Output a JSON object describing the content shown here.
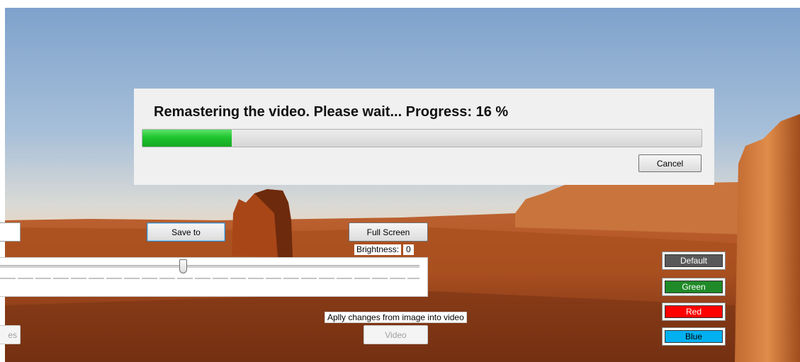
{
  "progress_dialog": {
    "message": "Remastering the video. Please wait... Progress: 16 %",
    "progress": 0.16,
    "cancel_label": "Cancel"
  },
  "toolbar": {
    "save_to_label": "Save to",
    "full_screen_label": "Full Screen",
    "brightness_label": "Brightness:",
    "brightness_value": "0"
  },
  "apply": {
    "hint": "Aplly changes from image into video",
    "video_label": "Video",
    "left_partial_label": "es"
  },
  "color_buttons": [
    {
      "label": "Default",
      "color": "#595959",
      "text_color": "#ffffff"
    },
    {
      "label": "Green",
      "color": "#1f8a27",
      "text_color": "#ffffff"
    },
    {
      "label": "Red",
      "color": "#ff0000",
      "text_color": "#ffffff"
    },
    {
      "label": "Blue",
      "color": "#00b0f0",
      "text_color": "#000000"
    }
  ],
  "colors": {
    "progress_fill": "#1fc52f",
    "dialog_bg": "#f0f0f0"
  }
}
